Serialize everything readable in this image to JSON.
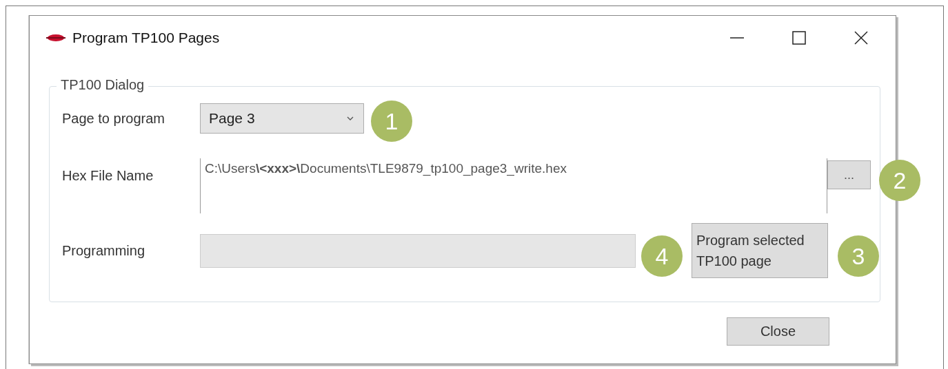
{
  "window": {
    "title": "Program TP100 Pages"
  },
  "group": {
    "title": "TP100 Dialog"
  },
  "page_select": {
    "label": "Page to program",
    "value": "Page 3",
    "callout": "1"
  },
  "hex_file": {
    "label": "Hex File Name",
    "value": "C:\\Users**\\<xxx>\\**Documents\\TLE9879_tp100_page3_write.hex",
    "browse_label": "...",
    "browse_callout": "2"
  },
  "programming": {
    "label": "Programming",
    "level": 0,
    "progress_callout": "4",
    "button": "Program selected TP100 page",
    "button_callout": "3"
  },
  "buttons": [
    "Close"
  ]
}
